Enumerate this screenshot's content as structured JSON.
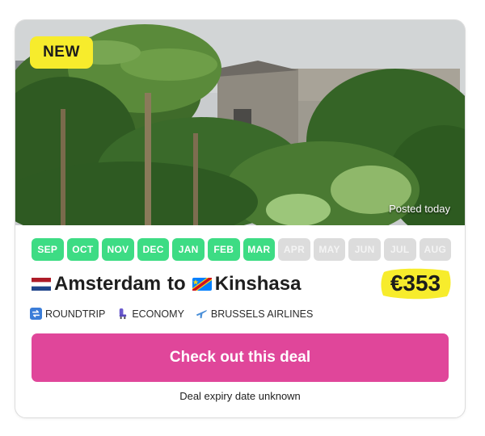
{
  "card": {
    "badge": "NEW",
    "posted": "Posted today",
    "months": [
      {
        "label": "SEP",
        "active": true
      },
      {
        "label": "OCT",
        "active": true
      },
      {
        "label": "NOV",
        "active": true
      },
      {
        "label": "DEC",
        "active": true
      },
      {
        "label": "JAN",
        "active": true
      },
      {
        "label": "FEB",
        "active": true
      },
      {
        "label": "MAR",
        "active": true
      },
      {
        "label": "APR",
        "active": false
      },
      {
        "label": "MAY",
        "active": false
      },
      {
        "label": "JUN",
        "active": false
      },
      {
        "label": "JUL",
        "active": false
      },
      {
        "label": "AUG",
        "active": false
      }
    ],
    "origin": "Amsterdam",
    "connector": "to",
    "destination": "Kinshasa",
    "origin_flag": "flag-netherlands-icon",
    "destination_flag": "flag-dr-congo-icon",
    "price": "€353",
    "trip_type": "ROUNDTRIP",
    "cabin": "ECONOMY",
    "airline": "BRUSSELS AIRLINES",
    "cta_label": "Check out this deal",
    "expiry": "Deal expiry date unknown"
  },
  "colors": {
    "badge": "#f7ec2c",
    "month_active": "#3ddc84",
    "month_inactive": "#dcdcdc",
    "cta": "#e0469a",
    "price_highlight": "#f7ec2c"
  }
}
